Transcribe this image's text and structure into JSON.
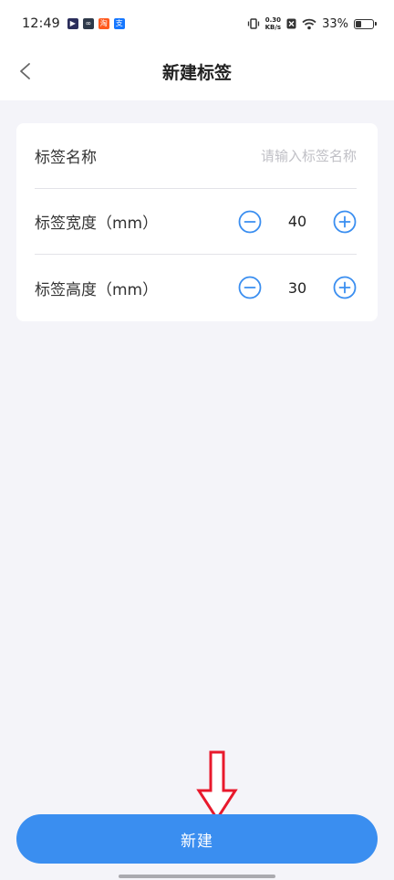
{
  "status_bar": {
    "time": "12:49",
    "net_speed_value": "0.30",
    "net_speed_unit": "KB/s",
    "battery_percent": "33%",
    "battery_level": 0.33,
    "app_icons": [
      {
        "name": "video-app-icon",
        "glyph": "▶",
        "color": "#2b2e5c"
      },
      {
        "name": "loop-app-icon",
        "glyph": "∞",
        "color": "#2f3a4a"
      },
      {
        "name": "taobao-app-icon",
        "glyph": "淘",
        "color": "#ff5a1f"
      },
      {
        "name": "alipay-app-icon",
        "glyph": "支",
        "color": "#1677ff"
      }
    ]
  },
  "nav": {
    "title": "新建标签"
  },
  "form": {
    "name": {
      "label": "标签名称",
      "value": "",
      "placeholder": "请输入标签名称"
    },
    "width": {
      "label": "标签宽度（mm）",
      "value": "40"
    },
    "height": {
      "label": "标签高度（mm）",
      "value": "30"
    }
  },
  "actions": {
    "create_label": "新建"
  },
  "colors": {
    "accent": "#3a8ef0",
    "stepper_icon": "#3a8ef0",
    "annotation_arrow": "#e8192c",
    "background": "#f4f4f9"
  }
}
